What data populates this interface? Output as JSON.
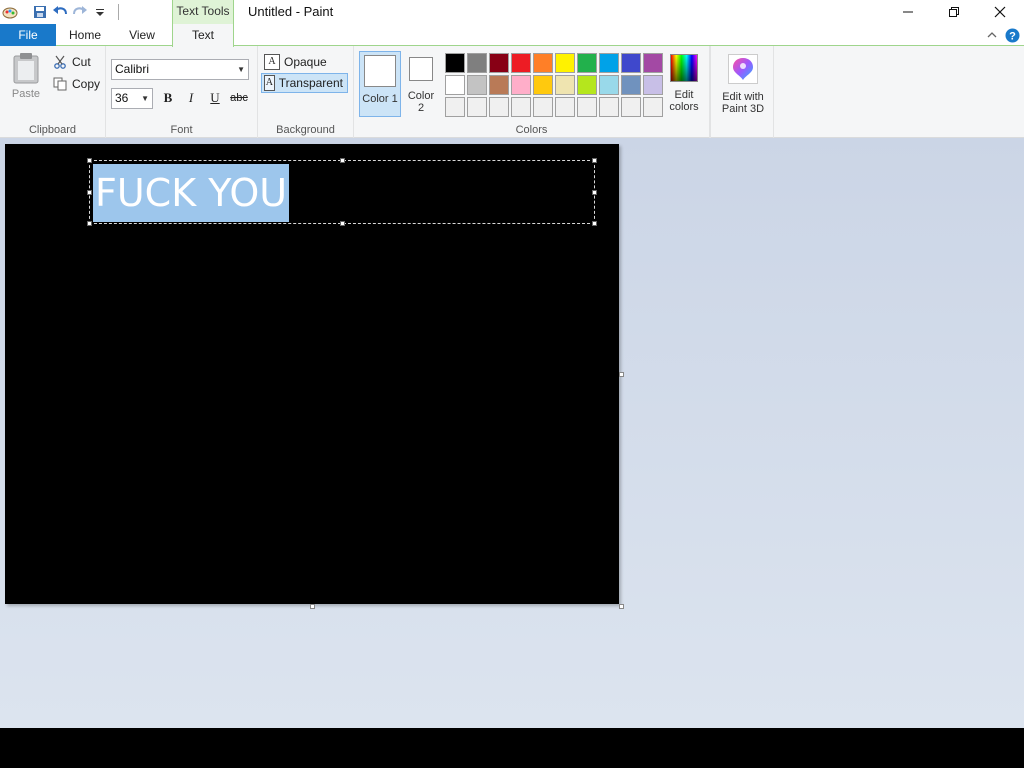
{
  "window": {
    "title": "Untitled - Paint",
    "contextual_group": "Text Tools"
  },
  "tabs": {
    "file": "File",
    "home": "Home",
    "view": "View",
    "text": "Text"
  },
  "clipboard": {
    "paste": "Paste",
    "cut": "Cut",
    "copy": "Copy",
    "label": "Clipboard"
  },
  "font": {
    "family": "Calibri",
    "size": "36",
    "bold": "B",
    "italic": "I",
    "underline": "U",
    "strikethrough": "abc",
    "label": "Font"
  },
  "background": {
    "opaque": "Opaque",
    "transparent": "Transparent",
    "label": "Background"
  },
  "colors": {
    "color1": "Color 1",
    "color2": "Color 2",
    "edit_colors": "Edit colors",
    "label": "Colors",
    "palette_row1": [
      "#000000",
      "#7f7f7f",
      "#880015",
      "#ed1c24",
      "#ff7f27",
      "#fff200",
      "#22b14c",
      "#00a2e8",
      "#3f48cc",
      "#a349a4"
    ],
    "palette_row2": [
      "#ffffff",
      "#c3c3c3",
      "#b97a57",
      "#ffaec9",
      "#ffc90e",
      "#efe4b0",
      "#b5e61d",
      "#99d9ea",
      "#7092be",
      "#c8bfe7"
    ],
    "palette_row3": [
      "#f0f0f0",
      "#f0f0f0",
      "#f0f0f0",
      "#f0f0f0",
      "#f0f0f0",
      "#f0f0f0",
      "#f0f0f0",
      "#f0f0f0",
      "#f0f0f0",
      "#f0f0f0"
    ]
  },
  "paint3d": {
    "label": "Edit with Paint 3D"
  },
  "canvas": {
    "text": "FUCK YOU"
  }
}
